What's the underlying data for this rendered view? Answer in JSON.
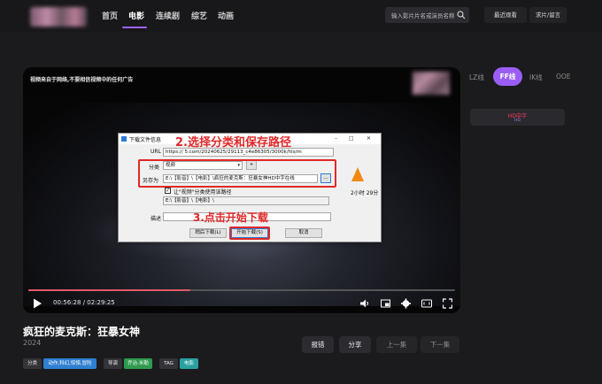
{
  "nav": {
    "items": [
      "首页",
      "电影",
      "连续剧",
      "综艺",
      "动画"
    ],
    "search_placeholder": "输入影片片名或演员名称",
    "recent_label": "最近观看",
    "request_label": "求片/留言"
  },
  "player": {
    "notice": "视频来自于网络,不要相信视频中的任何广告",
    "current_time": "00:56:28",
    "separator": "/",
    "total_time": "02:29:25",
    "progress": 0.38
  },
  "dialog": {
    "title": "下载文件信息",
    "url_label": "URL",
    "url_value": "https://                    5.com/20240625/29113_c4e86305/3000k/hls/m",
    "category_label": "分类",
    "category_value": "视频",
    "category_add": "+",
    "saveas_label": "另存为",
    "saveas_value": "E:\\【影音】\\【电影】\\疯狂的麦克斯：狂暴女神HD中字在线",
    "browse": "...",
    "checkbox_label": "让\"视频\"分类使用该路径",
    "path_value": "E:\\【影音】\\【电影】\\",
    "desc_label": "描述",
    "duration": "2小时 29分",
    "later_button": "稍后下载(L)",
    "start_button": "开始下载(S)",
    "cancel_button": "取消",
    "annotation_1": "2.选择分类和保存路径",
    "annotation_2": "3.点击开始下载"
  },
  "lines": {
    "tabs": [
      "LZ线",
      "FF线",
      "IK线",
      "OOE"
    ],
    "active": "FF线",
    "hd_badge_top": "HD中字",
    "hd_badge_bottom": "HD"
  },
  "movie": {
    "title": "疯狂的麦克斯：狂暴女神",
    "year": "2024",
    "actions": [
      "报错",
      "分享",
      "上一集",
      "下一集"
    ],
    "tags": [
      {
        "key": "分类",
        "value": "动作,科幻,惊悚,冒险",
        "color": "#2f7fd1"
      },
      {
        "key": "导演",
        "value": "乔治·米勒",
        "color": "#2f9a4e"
      },
      {
        "key": "TAG",
        "value": "电影",
        "color": "#2aa0a0"
      }
    ]
  },
  "colors": {
    "accent": "#9a5ef4",
    "annotation": "#e02828",
    "progress": "#e05a6a"
  }
}
